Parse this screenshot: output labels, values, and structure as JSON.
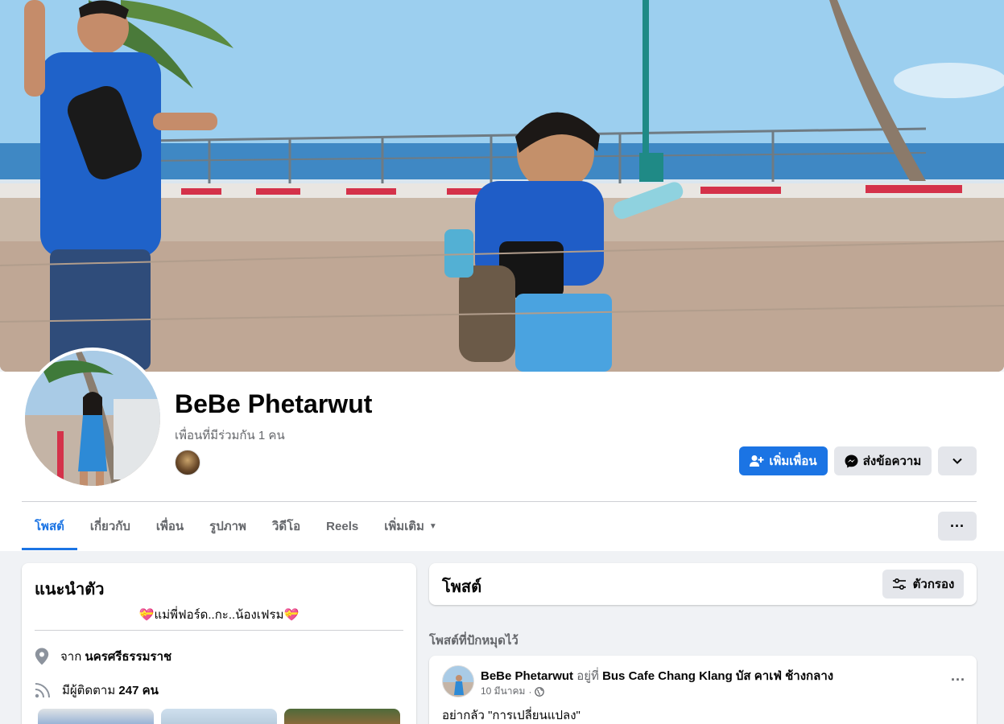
{
  "profile": {
    "name": "BeBe Phetarwut",
    "mutual_friends": "เพื่อนที่มีร่วมกัน 1 คน"
  },
  "actions": {
    "add_friend": "เพิ่มเพื่อน",
    "message": "ส่งข้อความ"
  },
  "tabs": [
    {
      "label": "โพสต์",
      "active": true
    },
    {
      "label": "เกี่ยวกับ"
    },
    {
      "label": "เพื่อน"
    },
    {
      "label": "รูปภาพ"
    },
    {
      "label": "วิดีโอ"
    },
    {
      "label": "Reels"
    },
    {
      "label": "เพิ่มเติม"
    }
  ],
  "intro": {
    "title": "แนะนำตัว",
    "bio": "💝แม่พี่ฟอร์ด..กะ..น้องเฟรม💝",
    "from_prefix": "จาก",
    "from_place": "นครศรีธรรมราช",
    "followers_prefix": "มีผู้ติดตาม",
    "followers_count": "247 คน"
  },
  "posts": {
    "title": "โพสต์",
    "filter_label": "ตัวกรอง",
    "pinned_label": "โพสต์ที่ปักหมุดไว้"
  },
  "post": {
    "author": "BeBe Phetarwut",
    "at_text": "อยู่ที่",
    "place": "Bus Cafe Chang Klang บัส คาเฟ่ ช้างกลาง",
    "date": "10 มีนาคม",
    "text": "อย่ากลัว \"การเปลี่ยนแปลง\""
  },
  "colors": {
    "accent": "#1b74e4",
    "background": "#f0f2f5",
    "muted_text": "#65676b",
    "secondary_button": "#e4e6eb"
  },
  "icons": {
    "add_friend": "person-plus-icon",
    "message": "messenger-icon",
    "more": "chevron-down-icon",
    "location": "location-pin-icon",
    "followers": "rss-icon",
    "filter": "sliders-icon",
    "privacy": "globe-icon"
  }
}
